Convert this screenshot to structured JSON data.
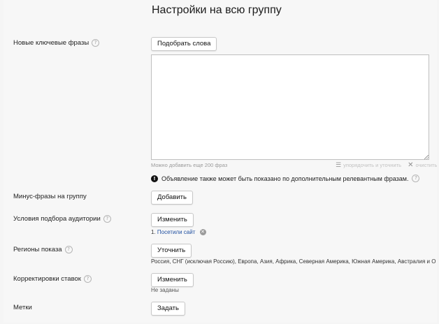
{
  "header": {
    "title": "Настройки на всю группу"
  },
  "keywords": {
    "label": "Новые ключевые фразы",
    "pick_button": "Подобрать слова",
    "textarea_value": "",
    "hint": "Можно добавить еще 200 фраз",
    "tool_order": "упорядочить и уточнить",
    "tool_clear": "очистить",
    "notice": "Объявление также может быть показано по дополнительным релевантным фразам."
  },
  "minus": {
    "label": "Минус-фразы на группу",
    "button": "Добавить"
  },
  "audience": {
    "label": "Условия подбора аудитории",
    "button": "Изменить",
    "item_number": "1.",
    "item_link": "Посетили сайт"
  },
  "regions": {
    "label": "Регионы показа",
    "button": "Уточнить",
    "value": "Россия, СНГ (исключая Россию), Европа, Азия, Африка, Северная Америка, Южная Америка, Австралия и О"
  },
  "bids": {
    "label": "Корректировки ставок",
    "button": "Изменить",
    "value": "Не заданы"
  },
  "tags": {
    "label": "Метки",
    "button": "Задать"
  }
}
